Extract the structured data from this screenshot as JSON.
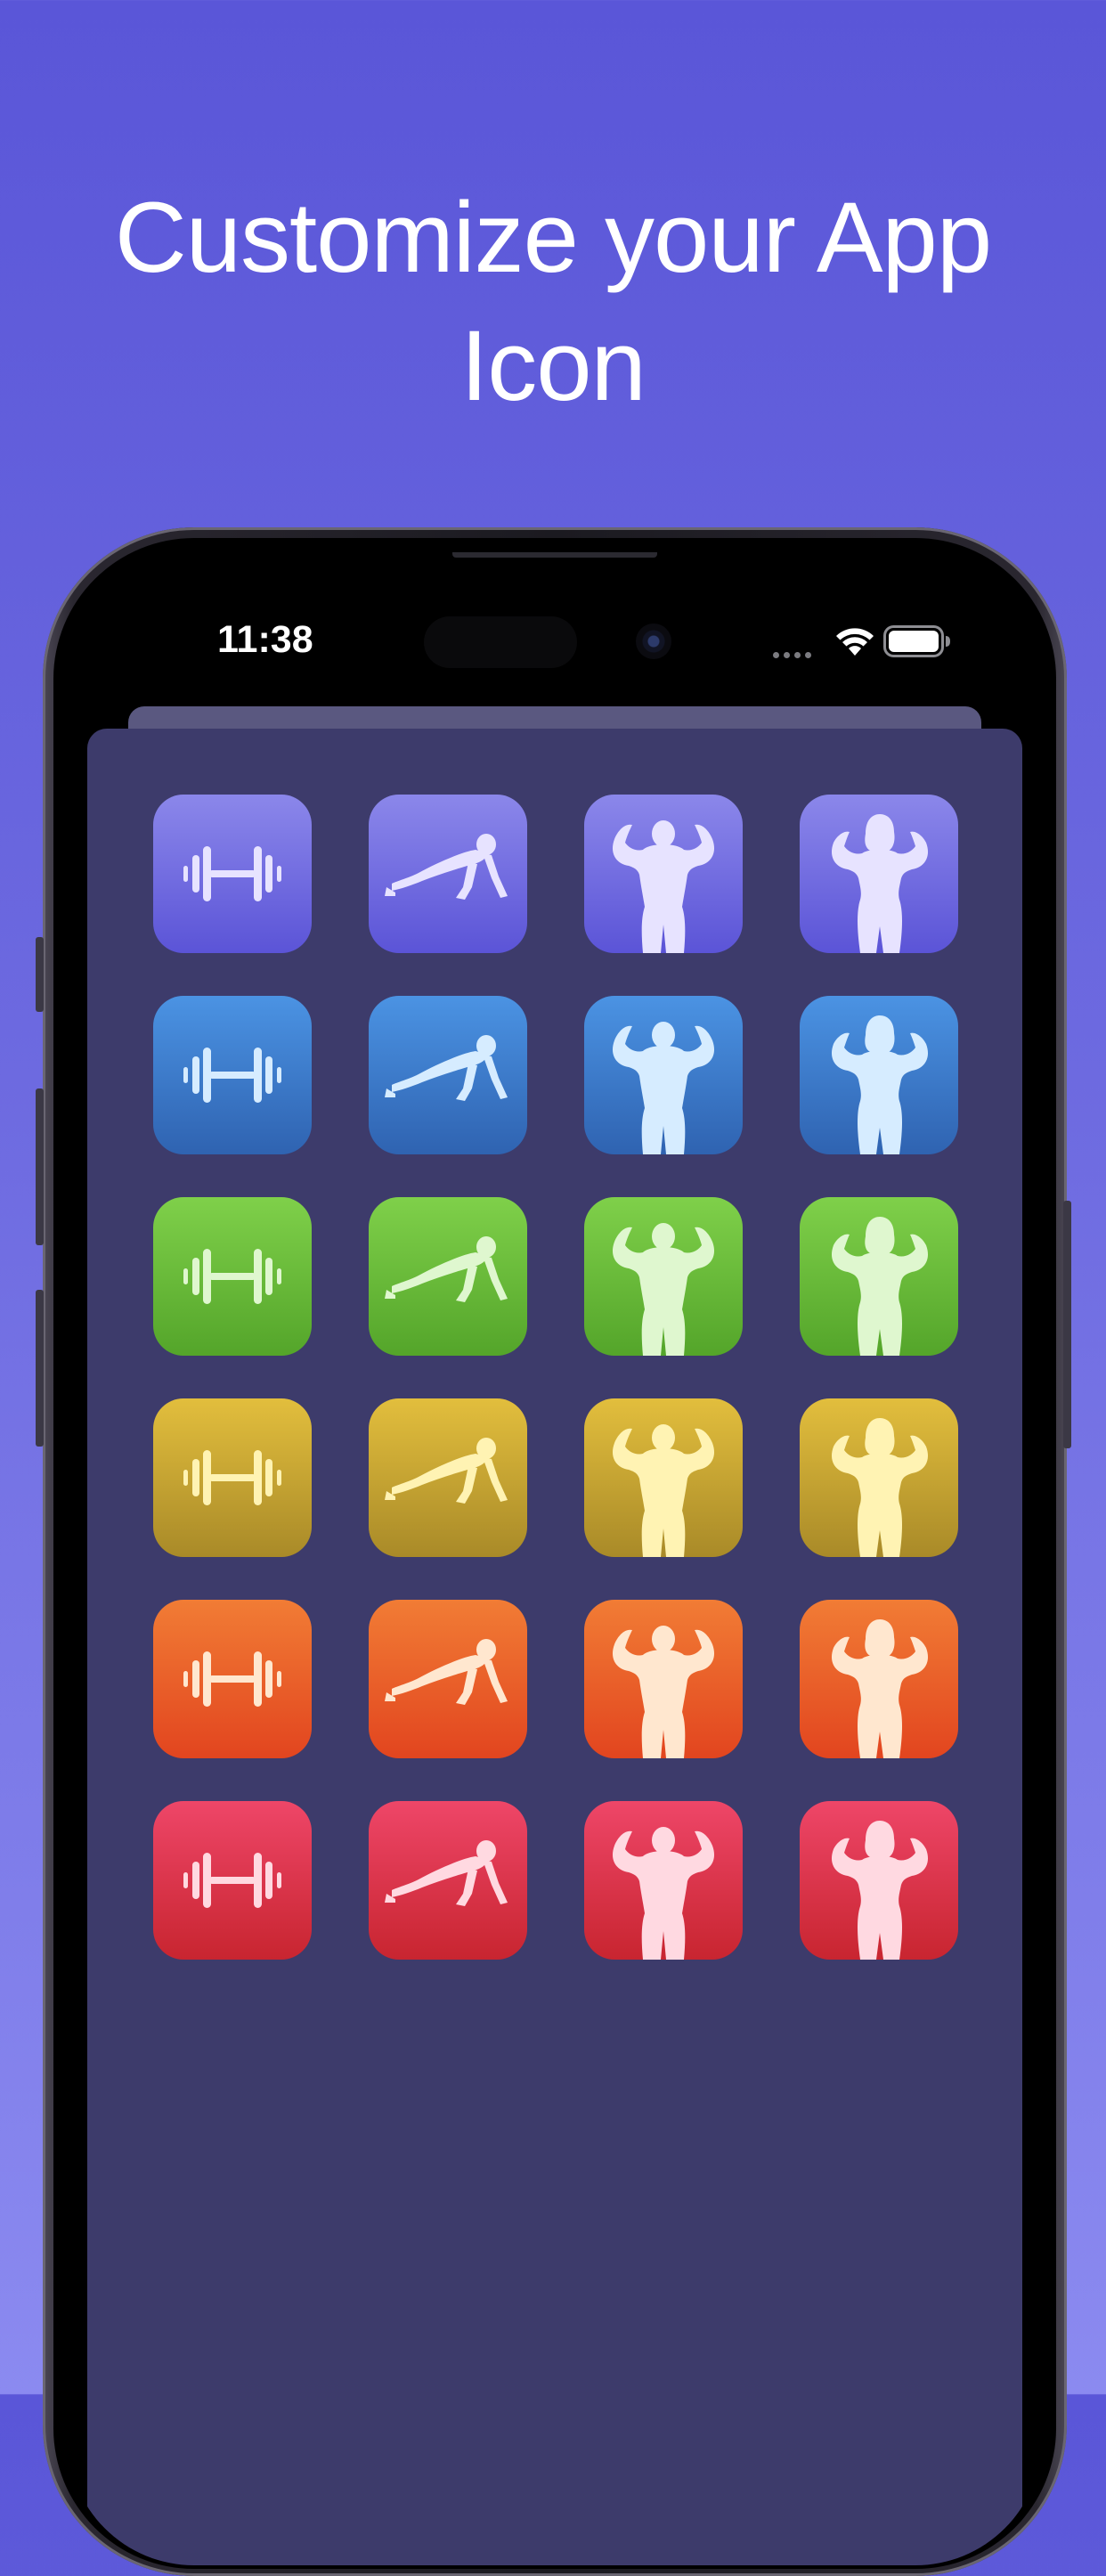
{
  "headline": {
    "line1": "Customize your App",
    "line2": "Icon"
  },
  "status_bar": {
    "time": "11:38",
    "icons": [
      "signal-dots-icon",
      "wifi-icon",
      "battery-icon"
    ]
  },
  "icon_grid": {
    "designs": [
      "dumbbell",
      "pushup",
      "man-flexing",
      "woman-flexing"
    ],
    "themes": [
      {
        "name": "purple",
        "top": "#8b87ea",
        "bottom": "#5b54d7",
        "glyph": "#e7e3ff"
      },
      {
        "name": "blue",
        "top": "#4b93e3",
        "bottom": "#2f63b1",
        "glyph": "#d6ecff"
      },
      {
        "name": "green",
        "top": "#7fd04a",
        "bottom": "#54a52a",
        "glyph": "#dff7cf"
      },
      {
        "name": "yellow",
        "top": "#e2be3d",
        "bottom": "#a98a28",
        "glyph": "#fff3b3"
      },
      {
        "name": "orange",
        "top": "#f17c35",
        "bottom": "#e2451f",
        "glyph": "#ffe7cf"
      },
      {
        "name": "red",
        "top": "#ee4668",
        "bottom": "#c82530",
        "glyph": "#ffd9e1"
      }
    ]
  }
}
